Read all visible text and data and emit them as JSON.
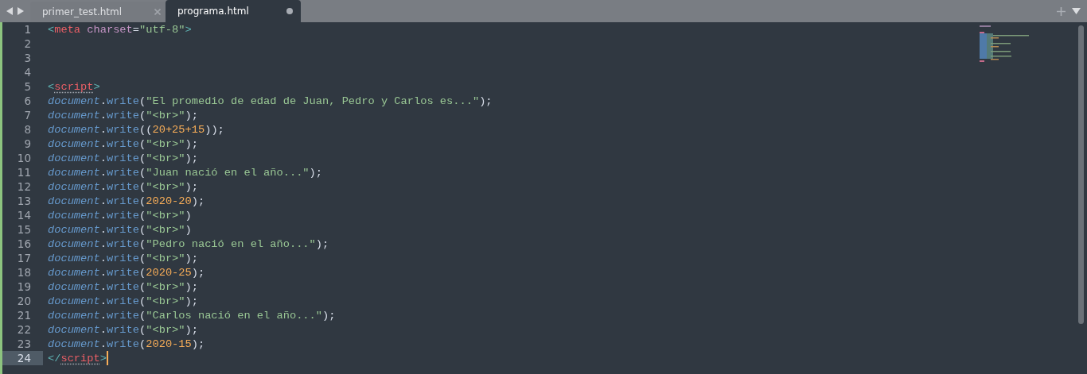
{
  "tabs": [
    {
      "label": "primer_test.html",
      "selected": false,
      "modified": false
    },
    {
      "label": "programa.html",
      "selected": true,
      "modified": true
    }
  ],
  "lines": [
    {
      "number": "1",
      "current": false,
      "tokens": [
        {
          "kind": "p",
          "text": "<"
        },
        {
          "kind": "t",
          "text": "meta"
        },
        {
          "kind": "a",
          "text": " charset"
        },
        {
          "kind": "x",
          "text": "="
        },
        {
          "kind": "s",
          "text": "\"utf-8\""
        },
        {
          "kind": "p",
          "text": ">"
        }
      ]
    },
    {
      "number": "2",
      "current": false
    },
    {
      "number": "3",
      "current": false
    },
    {
      "number": "4",
      "current": false
    },
    {
      "number": "5",
      "current": false,
      "tokens": [
        {
          "kind": "p",
          "text": "<"
        },
        {
          "kind": "tf",
          "text": "script"
        },
        {
          "kind": "p",
          "text": ">"
        }
      ]
    },
    {
      "number": "6",
      "current": false,
      "tokens": [
        {
          "kind": "o",
          "text": "document"
        },
        {
          "kind": "x",
          "text": "."
        },
        {
          "kind": "m",
          "text": "write"
        },
        {
          "kind": "x",
          "text": "("
        },
        {
          "kind": "s",
          "text": "\"El promedio de edad de Juan, Pedro y Carlos es...\""
        },
        {
          "kind": "x",
          "text": ");"
        }
      ]
    },
    {
      "number": "7",
      "current": false,
      "tokens": [
        {
          "kind": "o",
          "text": "document"
        },
        {
          "kind": "x",
          "text": "."
        },
        {
          "kind": "m",
          "text": "write"
        },
        {
          "kind": "x",
          "text": "("
        },
        {
          "kind": "s",
          "text": "\"<br>\""
        },
        {
          "kind": "x",
          "text": ");"
        }
      ]
    },
    {
      "number": "8",
      "current": false,
      "tokens": [
        {
          "kind": "o",
          "text": "document"
        },
        {
          "kind": "x",
          "text": "."
        },
        {
          "kind": "m",
          "text": "write"
        },
        {
          "kind": "x",
          "text": "(("
        },
        {
          "kind": "n",
          "text": "20+25+15"
        },
        {
          "kind": "x",
          "text": "));"
        }
      ]
    },
    {
      "number": "9",
      "current": false,
      "tokens": [
        {
          "kind": "o",
          "text": "document"
        },
        {
          "kind": "x",
          "text": "."
        },
        {
          "kind": "m",
          "text": "write"
        },
        {
          "kind": "x",
          "text": "("
        },
        {
          "kind": "s",
          "text": "\"<br>\""
        },
        {
          "kind": "x",
          "text": ");"
        }
      ]
    },
    {
      "number": "10",
      "current": false,
      "tokens": [
        {
          "kind": "o",
          "text": "document"
        },
        {
          "kind": "x",
          "text": "."
        },
        {
          "kind": "m",
          "text": "write"
        },
        {
          "kind": "x",
          "text": "("
        },
        {
          "kind": "s",
          "text": "\"<br>\""
        },
        {
          "kind": "x",
          "text": ");"
        }
      ]
    },
    {
      "number": "11",
      "current": false,
      "tokens": [
        {
          "kind": "o",
          "text": "document"
        },
        {
          "kind": "x",
          "text": "."
        },
        {
          "kind": "m",
          "text": "write"
        },
        {
          "kind": "x",
          "text": "("
        },
        {
          "kind": "s",
          "text": "\"Juan nació en el año...\""
        },
        {
          "kind": "x",
          "text": ");"
        }
      ]
    },
    {
      "number": "12",
      "current": false,
      "tokens": [
        {
          "kind": "o",
          "text": "document"
        },
        {
          "kind": "x",
          "text": "."
        },
        {
          "kind": "m",
          "text": "write"
        },
        {
          "kind": "x",
          "text": "("
        },
        {
          "kind": "s",
          "text": "\"<br>\""
        },
        {
          "kind": "x",
          "text": ");"
        }
      ]
    },
    {
      "number": "13",
      "current": false,
      "tokens": [
        {
          "kind": "o",
          "text": "document"
        },
        {
          "kind": "x",
          "text": "."
        },
        {
          "kind": "m",
          "text": "write"
        },
        {
          "kind": "x",
          "text": "("
        },
        {
          "kind": "n",
          "text": "2020-20"
        },
        {
          "kind": "x",
          "text": ");"
        }
      ]
    },
    {
      "number": "14",
      "current": false,
      "tokens": [
        {
          "kind": "o",
          "text": "document"
        },
        {
          "kind": "x",
          "text": "."
        },
        {
          "kind": "m",
          "text": "write"
        },
        {
          "kind": "x",
          "text": "("
        },
        {
          "kind": "s",
          "text": "\"<br>\""
        },
        {
          "kind": "x",
          "text": ")"
        }
      ]
    },
    {
      "number": "15",
      "current": false,
      "tokens": [
        {
          "kind": "o",
          "text": "document"
        },
        {
          "kind": "x",
          "text": "."
        },
        {
          "kind": "m",
          "text": "write"
        },
        {
          "kind": "x",
          "text": "("
        },
        {
          "kind": "s",
          "text": "\"<br>\""
        },
        {
          "kind": "x",
          "text": ")"
        }
      ]
    },
    {
      "number": "16",
      "current": false,
      "tokens": [
        {
          "kind": "o",
          "text": "document"
        },
        {
          "kind": "x",
          "text": "."
        },
        {
          "kind": "m",
          "text": "write"
        },
        {
          "kind": "x",
          "text": "("
        },
        {
          "kind": "s",
          "text": "\"Pedro nació en el año...\""
        },
        {
          "kind": "x",
          "text": ");"
        }
      ]
    },
    {
      "number": "17",
      "current": false,
      "tokens": [
        {
          "kind": "o",
          "text": "document"
        },
        {
          "kind": "x",
          "text": "."
        },
        {
          "kind": "m",
          "text": "write"
        },
        {
          "kind": "x",
          "text": "("
        },
        {
          "kind": "s",
          "text": "\"<br>\""
        },
        {
          "kind": "x",
          "text": ");"
        }
      ]
    },
    {
      "number": "18",
      "current": false,
      "tokens": [
        {
          "kind": "o",
          "text": "document"
        },
        {
          "kind": "x",
          "text": "."
        },
        {
          "kind": "m",
          "text": "write"
        },
        {
          "kind": "x",
          "text": "("
        },
        {
          "kind": "n",
          "text": "2020-25"
        },
        {
          "kind": "x",
          "text": ");"
        }
      ]
    },
    {
      "number": "19",
      "current": false,
      "tokens": [
        {
          "kind": "o",
          "text": "document"
        },
        {
          "kind": "x",
          "text": "."
        },
        {
          "kind": "m",
          "text": "write"
        },
        {
          "kind": "x",
          "text": "("
        },
        {
          "kind": "s",
          "text": "\"<br>\""
        },
        {
          "kind": "x",
          "text": ");"
        }
      ]
    },
    {
      "number": "20",
      "current": false,
      "tokens": [
        {
          "kind": "o",
          "text": "document"
        },
        {
          "kind": "x",
          "text": "."
        },
        {
          "kind": "m",
          "text": "write"
        },
        {
          "kind": "x",
          "text": "("
        },
        {
          "kind": "s",
          "text": "\"<br>\""
        },
        {
          "kind": "x",
          "text": ");"
        }
      ]
    },
    {
      "number": "21",
      "current": false,
      "tokens": [
        {
          "kind": "o",
          "text": "document"
        },
        {
          "kind": "x",
          "text": "."
        },
        {
          "kind": "m",
          "text": "write"
        },
        {
          "kind": "x",
          "text": "("
        },
        {
          "kind": "s",
          "text": "\"Carlos nació en el año...\""
        },
        {
          "kind": "x",
          "text": ");"
        }
      ]
    },
    {
      "number": "22",
      "current": false,
      "tokens": [
        {
          "kind": "o",
          "text": "document"
        },
        {
          "kind": "x",
          "text": "."
        },
        {
          "kind": "m",
          "text": "write"
        },
        {
          "kind": "x",
          "text": "("
        },
        {
          "kind": "s",
          "text": "\"<br>\""
        },
        {
          "kind": "x",
          "text": ");"
        }
      ]
    },
    {
      "number": "23",
      "current": false,
      "tokens": [
        {
          "kind": "o",
          "text": "document"
        },
        {
          "kind": "x",
          "text": "."
        },
        {
          "kind": "m",
          "text": "write"
        },
        {
          "kind": "x",
          "text": "("
        },
        {
          "kind": "n",
          "text": "2020-15"
        },
        {
          "kind": "x",
          "text": ");"
        }
      ]
    },
    {
      "number": "24",
      "current": true,
      "tokens": [
        {
          "kind": "p",
          "text": "</"
        },
        {
          "kind": "tf",
          "text": "script"
        },
        {
          "kind": "p",
          "text": ">"
        }
      ]
    }
  ]
}
